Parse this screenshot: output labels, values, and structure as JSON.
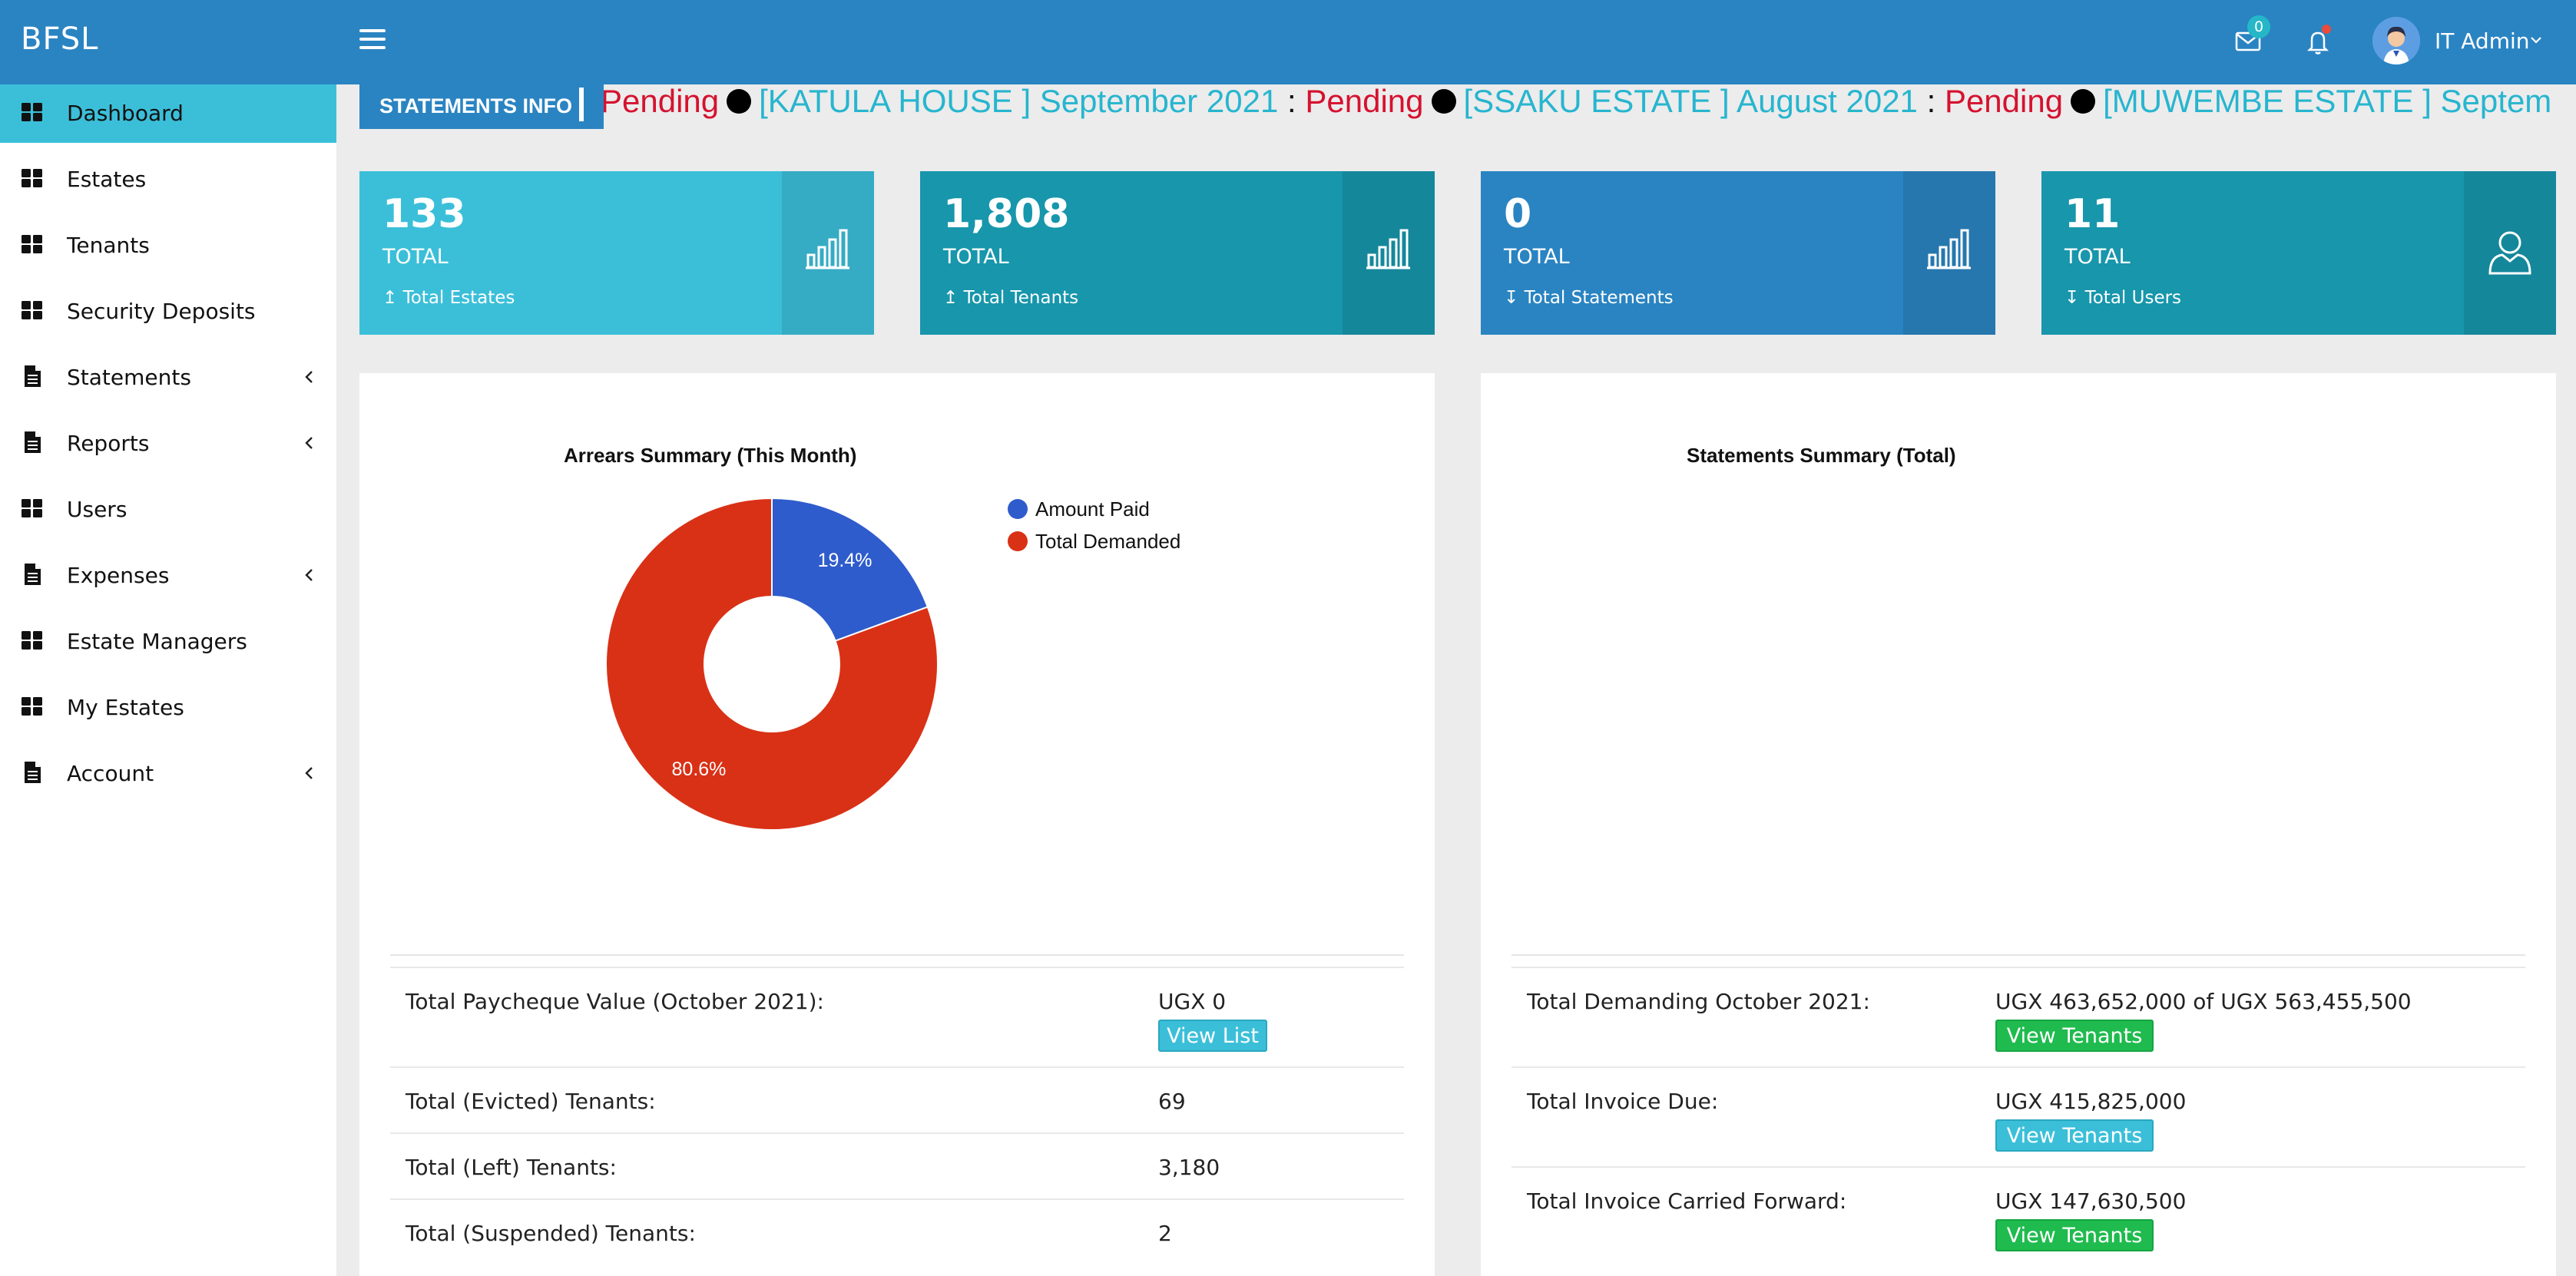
{
  "header": {
    "brand": "BFSL",
    "mail_badge": "0",
    "user_name": "IT Admin"
  },
  "sidebar": {
    "items": [
      {
        "label": "Dashboard",
        "icon": "grid-icon",
        "active": true,
        "has_chevron": false
      },
      {
        "label": "Estates",
        "icon": "grid-icon",
        "has_chevron": false
      },
      {
        "label": "Tenants",
        "icon": "grid-icon",
        "has_chevron": false
      },
      {
        "label": "Security Deposits",
        "icon": "grid-icon",
        "has_chevron": false
      },
      {
        "label": "Statements",
        "icon": "document-icon",
        "has_chevron": true
      },
      {
        "label": "Reports",
        "icon": "document-icon",
        "has_chevron": true
      },
      {
        "label": "Users",
        "icon": "grid-icon",
        "has_chevron": false
      },
      {
        "label": "Expenses",
        "icon": "document-icon",
        "has_chevron": true
      },
      {
        "label": "Estate Managers",
        "icon": "grid-icon",
        "has_chevron": false
      },
      {
        "label": "My Estates",
        "icon": "grid-icon",
        "has_chevron": false
      },
      {
        "label": "Account",
        "icon": "document-icon",
        "has_chevron": true
      }
    ]
  },
  "ticker": {
    "label": "STATEMENTS INFO",
    "entries": [
      {
        "estate": "",
        "status": "Pending"
      },
      {
        "estate": "[KATULA HOUSE ] September 2021",
        "status": "Pending"
      },
      {
        "estate": "[SSAKU ESTATE ] August 2021",
        "status": "Pending"
      },
      {
        "estate": "[MUWEMBE ESTATE ] Septem",
        "status": ""
      }
    ]
  },
  "cards": [
    {
      "number": "133",
      "total": "TOTAL",
      "sub": "Total Estates",
      "arrow": "↥",
      "icon": "bar-chart-icon",
      "color": "#3bbfd9",
      "side_color": "#36abc4"
    },
    {
      "number": "1,808",
      "total": "TOTAL",
      "sub": "Total Tenants",
      "arrow": "↥",
      "icon": "bar-chart-icon",
      "color": "#1796ac",
      "side_color": "#15879b"
    },
    {
      "number": "0",
      "total": "TOTAL",
      "sub": "Total Statements",
      "arrow": "↧",
      "icon": "bar-chart-icon",
      "color": "#2a84c2",
      "side_color": "#2677ae"
    },
    {
      "number": "11",
      "total": "TOTAL",
      "sub": "Total Users",
      "arrow": "↧",
      "icon": "user-icon",
      "color": "#1796ac",
      "side_color": "#15879b"
    }
  ],
  "left_panel": {
    "title": "Arrears Summary (This Month)",
    "rows": [
      {
        "label": "Total Paycheque Value (October 2021):",
        "value": "UGX 0",
        "button": "View List"
      },
      {
        "label": "Total (Evicted) Tenants:",
        "value": "69",
        "button": ""
      },
      {
        "label": "Total (Left) Tenants:",
        "value": "3,180",
        "button": ""
      },
      {
        "label": "Total (Suspended) Tenants:",
        "value": "2",
        "button": ""
      }
    ]
  },
  "right_panel": {
    "title": "Statements Summary (Total)",
    "rows": [
      {
        "label": "Total Demanding October 2021:",
        "value": "UGX 463,652,000 of UGX 563,455,500",
        "button": "View Tenants",
        "button_style": "green"
      },
      {
        "label": "Total Invoice Due:",
        "value": "UGX 415,825,000",
        "button": "View Tenants",
        "button_style": "blue"
      },
      {
        "label": "Total Invoice Carried Forward:",
        "value": "UGX 147,630,500",
        "button": "View Tenants",
        "button_style": "green"
      }
    ]
  },
  "chart_data": {
    "type": "pie",
    "title": "Arrears Summary (This Month)",
    "donut": true,
    "categories": [
      "Amount Paid",
      "Total Demanded"
    ],
    "values": [
      19.4,
      80.6
    ],
    "labels": [
      "19.4%",
      "80.6%"
    ],
    "colors": [
      "#2f5ccc",
      "#d93116"
    ],
    "legend": "top-right"
  }
}
